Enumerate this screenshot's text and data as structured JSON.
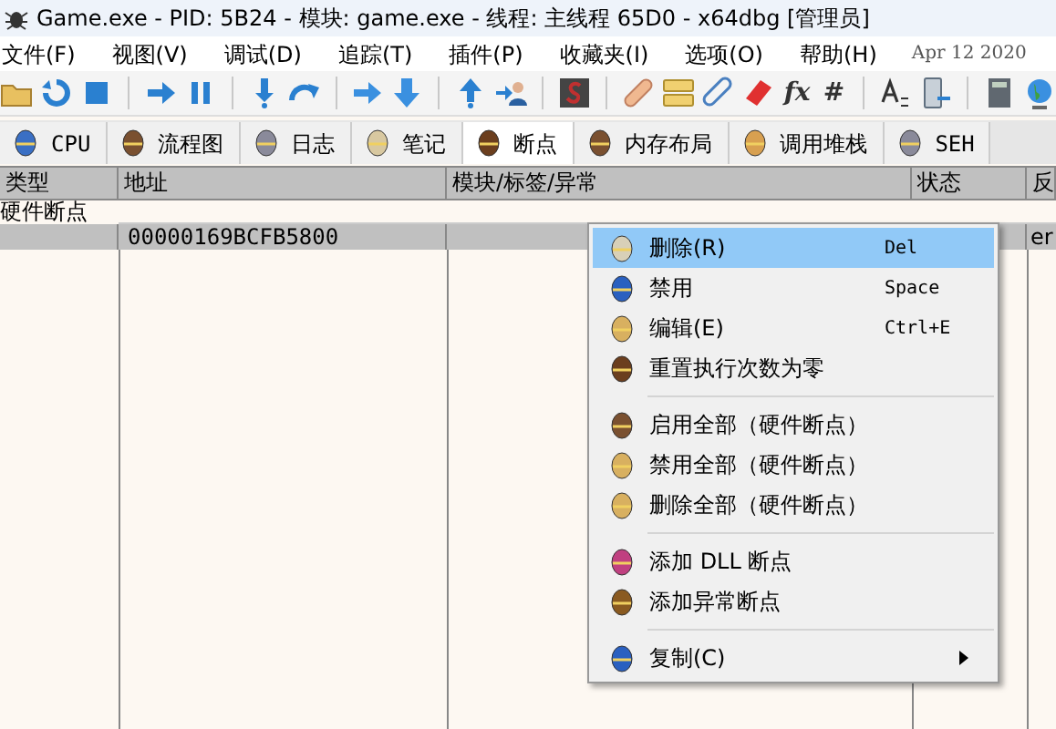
{
  "window": {
    "title": "Game.exe - PID: 5B24 - 模块: game.exe - 线程: 主线程 65D0 - x64dbg [管理员]"
  },
  "menu": [
    "文件(F)",
    "视图(V)",
    "调试(D)",
    "追踪(T)",
    "插件(P)",
    "收藏夹(I)",
    "选项(O)",
    "帮助(H)"
  ],
  "build_date": "Apr 12 2020",
  "toolbar": [
    {
      "kind": "open"
    },
    {
      "kind": "restart"
    },
    {
      "kind": "stop"
    },
    {
      "kind": "sep"
    },
    {
      "kind": "run"
    },
    {
      "kind": "pause"
    },
    {
      "kind": "sep"
    },
    {
      "kind": "stepin"
    },
    {
      "kind": "stepover"
    },
    {
      "kind": "sep"
    },
    {
      "kind": "trace"
    },
    {
      "kind": "down"
    },
    {
      "kind": "sep"
    },
    {
      "kind": "up"
    },
    {
      "kind": "user"
    },
    {
      "kind": "sep"
    },
    {
      "kind": "script"
    },
    {
      "kind": "sep"
    },
    {
      "kind": "patch"
    },
    {
      "kind": "comment"
    },
    {
      "kind": "label"
    },
    {
      "kind": "bookmark"
    },
    {
      "kind": "fx",
      "text": "fx"
    },
    {
      "kind": "hash",
      "text": "#"
    },
    {
      "kind": "sep"
    },
    {
      "kind": "font"
    },
    {
      "kind": "device"
    },
    {
      "kind": "sep"
    },
    {
      "kind": "calc"
    },
    {
      "kind": "globe"
    }
  ],
  "tabs": [
    {
      "label": "CPU",
      "selected": false
    },
    {
      "label": "流程图",
      "selected": false
    },
    {
      "label": "日志",
      "selected": false
    },
    {
      "label": "笔记",
      "selected": false
    },
    {
      "label": "断点",
      "selected": true
    },
    {
      "label": "内存布局",
      "selected": false
    },
    {
      "label": "调用堆栈",
      "selected": false
    },
    {
      "label": "SEH",
      "selected": false
    }
  ],
  "table": {
    "columns": [
      "类型",
      "地址",
      "模块/标签/异常",
      "状态",
      "反"
    ],
    "group": "硬件断点",
    "rows": [
      {
        "address": "00000169BCFB5800",
        "column_5": "er",
        "selected": true
      }
    ]
  },
  "context_menu": [
    {
      "kind": "item",
      "label": "删除(R)",
      "shortcut": "Del",
      "selected": true
    },
    {
      "kind": "item",
      "label": "禁用",
      "shortcut": "Space",
      "selected": false
    },
    {
      "kind": "item",
      "label": "编辑(E)",
      "shortcut": "Ctrl+E",
      "selected": false
    },
    {
      "kind": "item",
      "label": "重置执行次数为零",
      "selected": false
    },
    {
      "kind": "sep"
    },
    {
      "kind": "item",
      "label": "启用全部（硬件断点）",
      "selected": false
    },
    {
      "kind": "item",
      "label": "禁用全部（硬件断点）",
      "selected": false
    },
    {
      "kind": "item",
      "label": "删除全部（硬件断点）",
      "selected": false
    },
    {
      "kind": "sep"
    },
    {
      "kind": "item",
      "label": "添加 DLL 断点",
      "selected": false
    },
    {
      "kind": "item",
      "label": "添加异常断点",
      "selected": false
    },
    {
      "kind": "sep"
    },
    {
      "kind": "item",
      "label": "复制(C)",
      "selected": false,
      "submenu": true
    }
  ]
}
